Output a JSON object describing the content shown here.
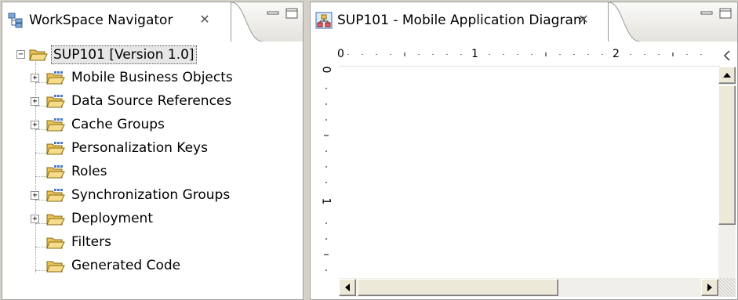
{
  "navigator": {
    "tab_title": "WorkSpace Navigator",
    "close_symbol": "✕",
    "root": {
      "label": "SUP101 [Version 1.0]",
      "expander": "−"
    },
    "items": [
      {
        "label": "Mobile Business Objects",
        "expander": "+",
        "icon": "package-folder-icon"
      },
      {
        "label": "Data Source References",
        "expander": "+",
        "icon": "package-folder-icon"
      },
      {
        "label": "Cache Groups",
        "expander": "+",
        "icon": "package-folder-icon"
      },
      {
        "label": "Personalization Keys",
        "expander": "",
        "icon": "package-folder-icon"
      },
      {
        "label": "Roles",
        "expander": "",
        "icon": "package-folder-icon"
      },
      {
        "label": "Synchronization Groups",
        "expander": "+",
        "icon": "package-folder-icon"
      },
      {
        "label": "Deployment",
        "expander": "+",
        "icon": "open-folder-icon"
      },
      {
        "label": "Filters",
        "expander": "",
        "icon": "open-folder-icon"
      },
      {
        "label": "Generated Code",
        "expander": "",
        "icon": "open-folder-icon"
      }
    ]
  },
  "diagram": {
    "tab_title": "SUP101 - Mobile Application Diagram",
    "close_symbol": "✕",
    "ruler_h_labels": [
      "0",
      "1",
      "2"
    ],
    "ruler_v_labels": [
      "0",
      "1"
    ]
  },
  "colors": {
    "tab_active": "#ffffff",
    "tab_strip": "#e8e6df",
    "folder": "#f0c43c",
    "selection": "#e6e6e6"
  }
}
